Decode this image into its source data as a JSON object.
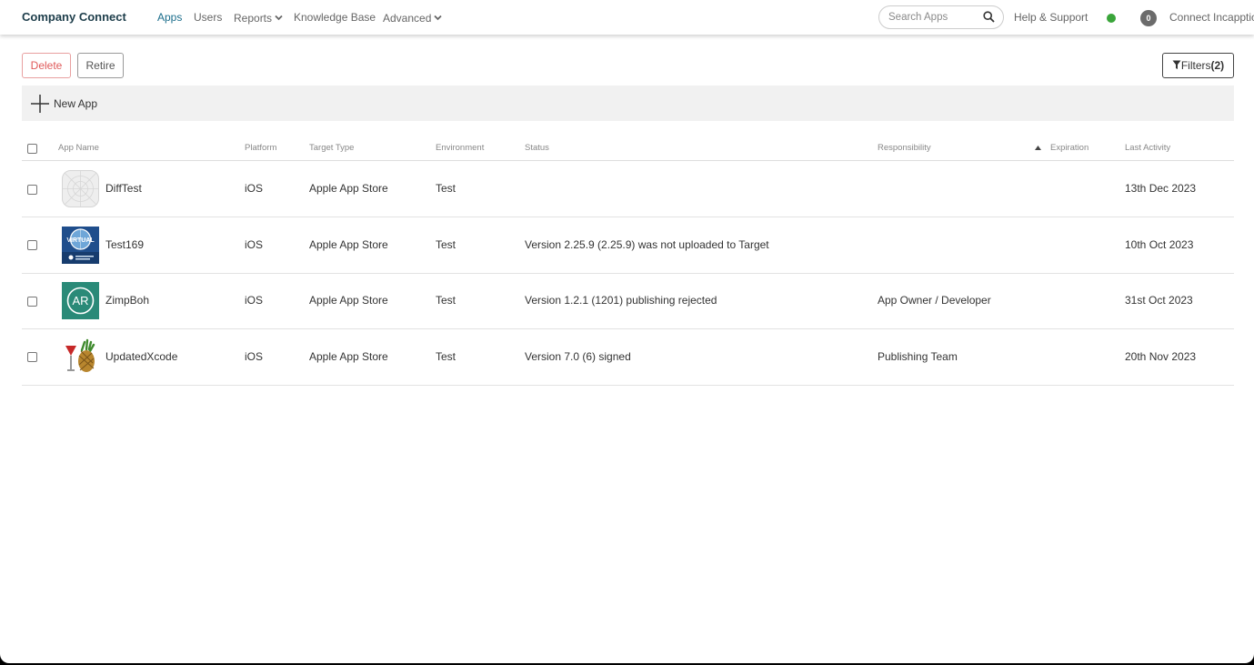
{
  "nav": {
    "brand": "Company Connect",
    "links": [
      "Apps",
      "Users",
      "Reports",
      "Knowledge Base",
      "Advanced"
    ],
    "search_placeholder": "Search Apps",
    "help": "Help & Support",
    "notifications": "0",
    "account": "Connect Incapptic"
  },
  "toolbar": {
    "delete": "Delete",
    "retire": "Retire",
    "filters_label": "Filters",
    "filters_count": "(2)",
    "new_app": "New App"
  },
  "table": {
    "headers": [
      "App Name",
      "Platform",
      "Target Type",
      "Environment",
      "Status",
      "Responsibility",
      "Expiration",
      "Last Activity"
    ],
    "rows": [
      {
        "name": "DiffTest",
        "platform": "iOS",
        "target": "Apple App Store",
        "env": "Test",
        "status": "",
        "responsibility": "",
        "expiration": "",
        "activity": "13th Dec 2023"
      },
      {
        "name": "Test169",
        "platform": "iOS",
        "target": "Apple App Store",
        "env": "Test",
        "status": "Version 2.25.9 (2.25.9) was not uploaded to Target",
        "responsibility": "",
        "expiration": "",
        "activity": "10th Oct 2023"
      },
      {
        "name": "ZimpBoh",
        "platform": "iOS",
        "target": "Apple App Store",
        "env": "Test",
        "status": "Version 1.2.1 (1201) publishing rejected",
        "responsibility": "App Owner / Developer",
        "expiration": "",
        "activity": "31st Oct 2023"
      },
      {
        "name": "UpdatedXcode",
        "platform": "iOS",
        "target": "Apple App Store",
        "env": "Test",
        "status": "Version 7.0 (6) signed",
        "responsibility": "Publishing Team",
        "expiration": "",
        "activity": "20th Nov 2023"
      }
    ],
    "icons": {
      "test169_text": "VIRTUAL",
      "zimpboh_text": "AR"
    }
  },
  "colors": {
    "brand": "#1d3d4a",
    "active_link": "#1c6e8c",
    "delete": "#e05a5a",
    "online": "#3aa53a",
    "zimpboh_icon": "#2a8a78"
  }
}
